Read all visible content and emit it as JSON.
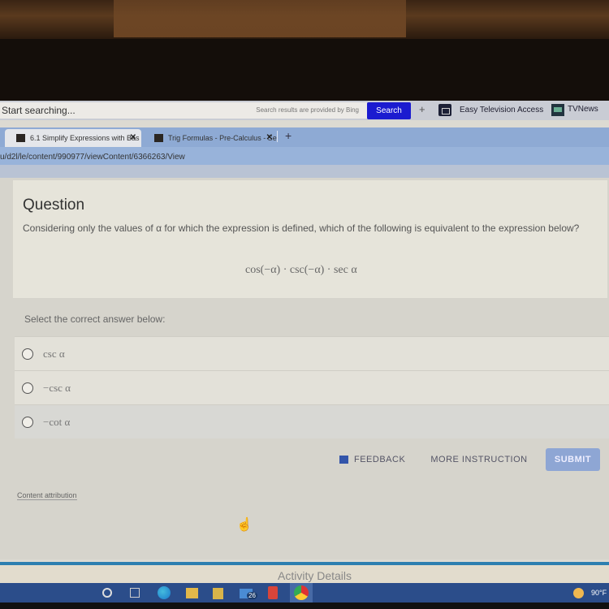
{
  "browser": {
    "bing_bar": {
      "search_placeholder": "Start searching...",
      "provider_text": "Search results are provided by Bing",
      "search_button": "Search",
      "add_icon": "plus-icon",
      "bookmarks": [
        {
          "label": "Easy Television Access",
          "icon": "tv-icon"
        },
        {
          "label": "TVNews",
          "icon": "tvnews-icon"
        }
      ]
    },
    "tabs": [
      {
        "label": "6.1 Simplify Expressions with Bas",
        "active": true
      },
      {
        "label": "Trig Formulas - Pre-Calculus - Se",
        "active": false
      }
    ],
    "new_tab_label": "+",
    "address": "u/d2l/le/content/990977/viewContent/6366263/View"
  },
  "question": {
    "title": "Question",
    "text": "Considering only the values of α for which the expression is defined, which of the following is equivalent to the expression below?",
    "expression": "cos(−α) · csc(−α) · sec α",
    "select_label": "Select the correct answer below:",
    "options": [
      {
        "label": "csc α",
        "selected": false
      },
      {
        "label": "−csc α",
        "selected": false
      },
      {
        "label": "−cot α",
        "selected": false
      }
    ]
  },
  "actions": {
    "feedback": "FEEDBACK",
    "more_instruction": "MORE INSTRUCTION",
    "submit": "SUBMIT"
  },
  "content_attribution": "Content attribution",
  "activity_details": "Activity Details",
  "taskbar": {
    "mail_badge": "26",
    "temperature": "90°F",
    "apps": [
      "search",
      "task-view",
      "edge",
      "file-explorer",
      "store",
      "mail",
      "office",
      "chrome"
    ]
  },
  "colors": {
    "search_button": "#1b1bd0",
    "submit_button": "#8ea6d4",
    "tab_bar": "#8eaad4",
    "taskbar": "#2b4d8a",
    "activity_line": "#2d7fb0"
  }
}
